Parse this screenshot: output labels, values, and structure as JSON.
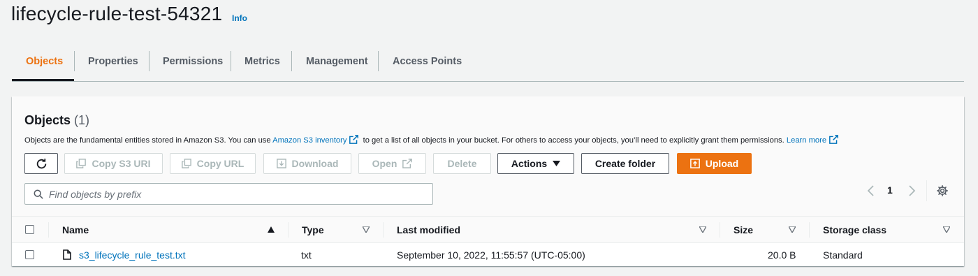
{
  "header": {
    "title": "lifecycle-rule-test-54321",
    "info_label": "Info"
  },
  "tabs": [
    {
      "label": "Objects",
      "active": true
    },
    {
      "label": "Properties",
      "active": false
    },
    {
      "label": "Permissions",
      "active": false
    },
    {
      "label": "Metrics",
      "active": false
    },
    {
      "label": "Management",
      "active": false
    },
    {
      "label": "Access Points",
      "active": false
    }
  ],
  "objects_panel": {
    "title": "Objects",
    "count": "(1)",
    "description_before": "Objects are the fundamental entities stored in Amazon S3. You can use",
    "inventory_link": "Amazon S3 inventory",
    "description_after": "to get a list of all objects in your bucket. For others to access your objects, you’ll need to explicitly grant them permissions.",
    "learn_more": "Learn more"
  },
  "toolbar": {
    "refresh_icon": "refresh-icon",
    "copy_s3_uri": "Copy S3 URI",
    "copy_url": "Copy URL",
    "download": "Download",
    "open": "Open",
    "delete": "Delete",
    "actions": "Actions",
    "create_folder": "Create folder",
    "upload": "Upload"
  },
  "search": {
    "placeholder": "Find objects by prefix",
    "value": ""
  },
  "pagination": {
    "current_page": "1"
  },
  "table": {
    "columns": {
      "name": "Name",
      "type": "Type",
      "last_modified": "Last modified",
      "size": "Size",
      "storage_class": "Storage class"
    },
    "rows": [
      {
        "name": "s3_lifecycle_rule_test.txt",
        "type": "txt",
        "last_modified": "September 10, 2022, 11:55:57 (UTC-05:00)",
        "size": "20.0 B",
        "storage_class": "Standard"
      }
    ]
  },
  "colors": {
    "accent_orange": "#ec7211",
    "link_blue": "#0073bb",
    "text_dark": "#16191f",
    "page_bg": "#f2f3f3"
  }
}
